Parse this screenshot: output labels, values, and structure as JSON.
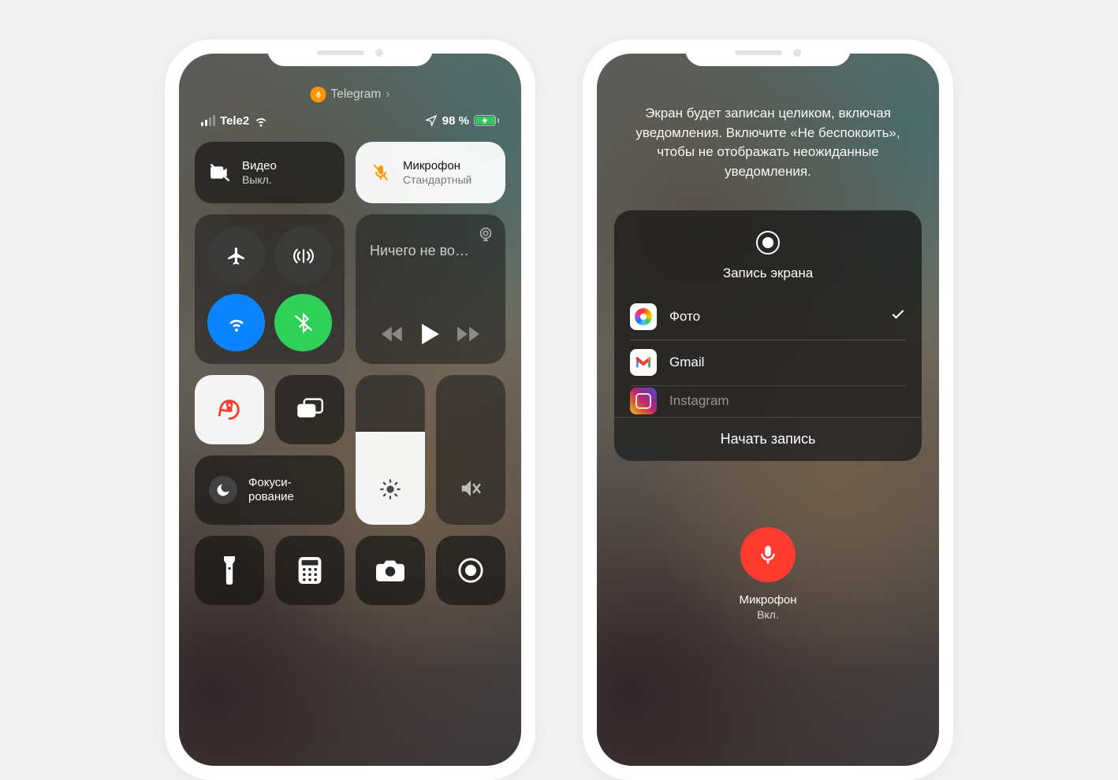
{
  "left": {
    "pill": {
      "app": "Telegram"
    },
    "status": {
      "carrier": "Tele2",
      "battery_pct": "98 %"
    },
    "tiles": {
      "video": {
        "title": "Видео",
        "subtitle": "Выкл."
      },
      "mic": {
        "title": "Микрофон",
        "subtitle": "Стандартный"
      },
      "media": {
        "now_playing": "Ничего не во…"
      },
      "focus": {
        "line1": "Фокуси-",
        "line2": "рование"
      }
    },
    "brightness_fill_pct": 62,
    "volume_fill_pct": 0
  },
  "right": {
    "notice": "Экран будет записан целиком, включая уведомления. Включите «Не беспокоить», чтобы не отображать неожиданные уведомления.",
    "card": {
      "title": "Запись экрана",
      "items": [
        {
          "name": "Фото",
          "icon": "photos",
          "selected": true
        },
        {
          "name": "Gmail",
          "icon": "gmail",
          "selected": false
        },
        {
          "name": "Instagram",
          "icon": "insta",
          "selected": false,
          "cut": true
        }
      ],
      "action": "Начать запись"
    },
    "mic": {
      "label": "Микрофон",
      "state": "Вкл."
    }
  }
}
